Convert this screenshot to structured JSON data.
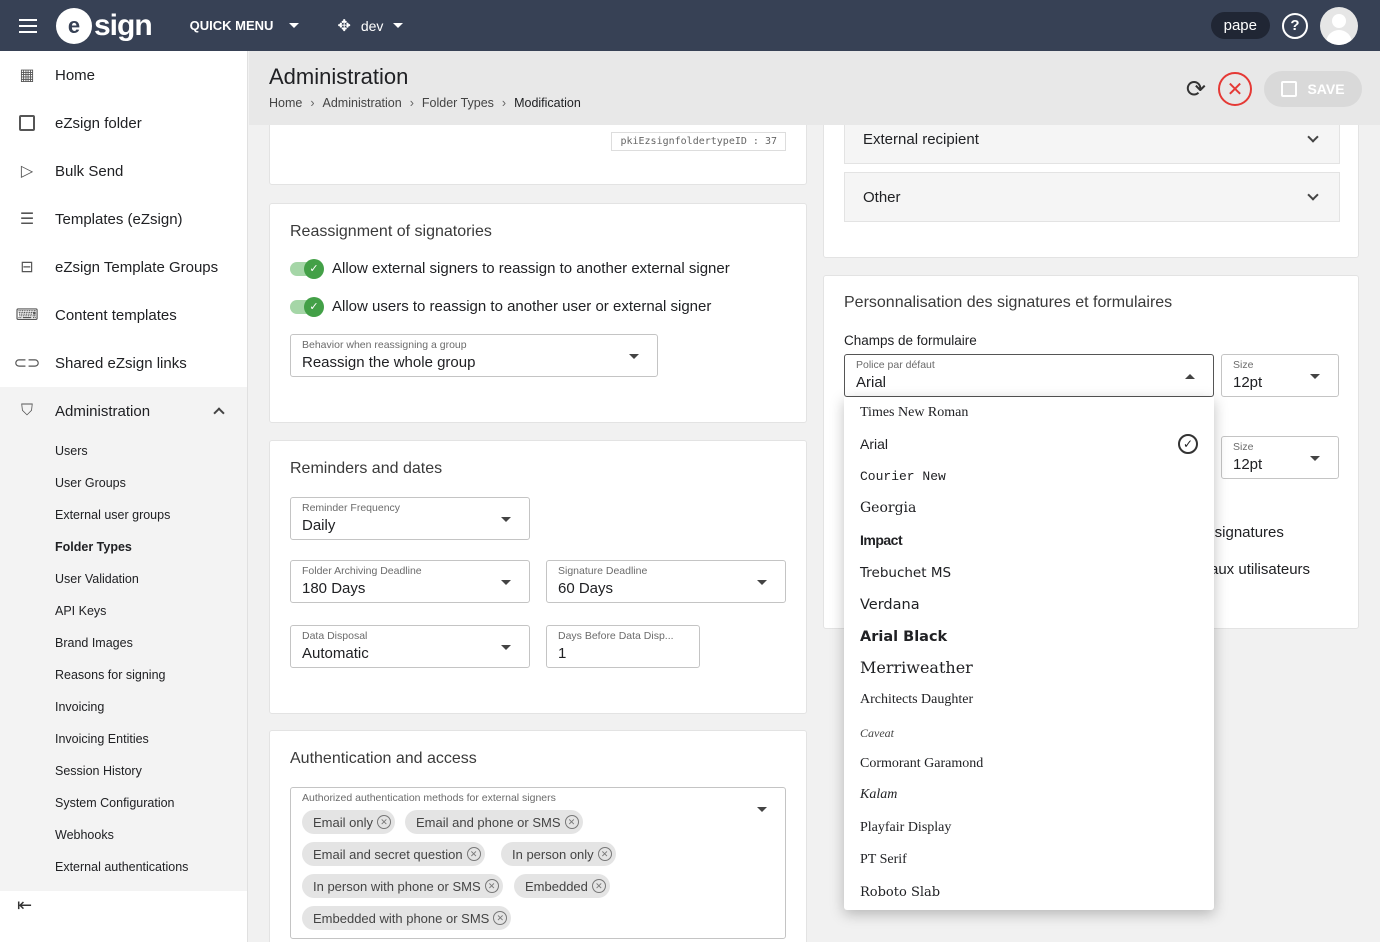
{
  "topbar": {
    "logo": "ezsign",
    "quick_menu": "QUICK MENU",
    "env": "dev",
    "user": "pape",
    "help": "?"
  },
  "sidebar": {
    "items": [
      {
        "label": "Home",
        "icon": "dashboard-icon"
      },
      {
        "label": "eZsign folder",
        "icon": "briefcase-icon"
      },
      {
        "label": "Bulk Send",
        "icon": "send-icon"
      },
      {
        "label": "Templates (eZsign)",
        "icon": "clipboard-icon"
      },
      {
        "label": "eZsign Template Groups",
        "icon": "archive-icon"
      },
      {
        "label": "Content templates",
        "icon": "keyboard-icon"
      },
      {
        "label": "Shared eZsign links",
        "icon": "link-icon"
      }
    ],
    "admin": {
      "label": "Administration",
      "subitems": [
        "Users",
        "User Groups",
        "External user groups",
        "Folder Types",
        "User Validation",
        "API Keys",
        "Brand Images",
        "Reasons for signing",
        "Invoicing",
        "Invoicing Entities",
        "Session History",
        "System Configuration",
        "Webhooks",
        "External authentications"
      ],
      "active": "Folder Types"
    }
  },
  "header": {
    "title": "Administration",
    "breadcrumb": [
      "Home",
      "Administration",
      "Folder Types",
      "Modification"
    ],
    "save_label": "SAVE"
  },
  "left": {
    "id_label": "pkiEzsignfoldertypeID : 37",
    "reassign": {
      "title": "Reassignment of signatories",
      "toggle1": "Allow external signers to reassign to another external signer",
      "toggle2": "Allow users to reassign to another user or external signer",
      "behavior_label": "Behavior when reassigning a group",
      "behavior_value": "Reassign the whole group"
    },
    "reminders": {
      "title": "Reminders and dates",
      "freq_label": "Reminder Frequency",
      "freq_value": "Daily",
      "archive_label": "Folder Archiving Deadline",
      "archive_value": "180 Days",
      "sig_label": "Signature Deadline",
      "sig_value": "60 Days",
      "disposal_label": "Data Disposal",
      "disposal_value": "Automatic",
      "days_label": "Days Before Data Disp...",
      "days_value": "1"
    },
    "auth": {
      "title": "Authentication and access",
      "methods_label": "Authorized authentication methods for external signers",
      "chips": [
        "Email only",
        "Email and phone or SMS",
        "Email and secret question",
        "In person only",
        "In person with phone or SMS",
        "Embedded",
        "Embedded with phone or SMS"
      ]
    }
  },
  "right": {
    "accordions": [
      "External recipient",
      "Other"
    ],
    "custom": {
      "title": "Personnalisation des signatures et formulaires",
      "section": "Champs de formulaire",
      "font_label": "Police par défaut",
      "font_value": "Arial",
      "size_label": "Size",
      "size_value": "12pt",
      "size2_label": "Size",
      "size2_value": "12pt",
      "behind1": "rs signatures",
      "behind2": "aux utilisateurs"
    },
    "font_options": [
      "Times New Roman",
      "Arial",
      "Courier New",
      "Georgia",
      "Impact",
      "Trebuchet MS",
      "Verdana",
      "Arial Black",
      "Merriweather",
      "Architects Daughter",
      "Caveat",
      "Cormorant Garamond",
      "Kalam",
      "Playfair Display",
      "PT Serif",
      "Roboto Slab"
    ],
    "selected_font": "Arial"
  }
}
